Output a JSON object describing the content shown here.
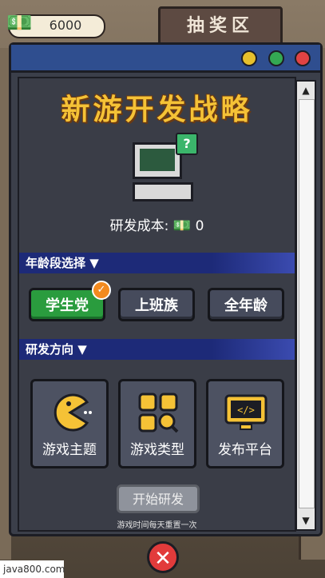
{
  "header": {
    "money": "6000",
    "sign_label": "抽奖区"
  },
  "window": {
    "title": "新游开发战略",
    "cost_label": "研发成本:",
    "cost_value": "0",
    "age_section": {
      "label": "年龄段选择",
      "options": [
        {
          "label": "学生党",
          "selected": true
        },
        {
          "label": "上班族",
          "selected": false
        },
        {
          "label": "全年龄",
          "selected": false
        }
      ]
    },
    "dir_section": {
      "label": "研发方向",
      "cards": [
        {
          "label": "游戏主题",
          "icon": "pacman-icon"
        },
        {
          "label": "游戏类型",
          "icon": "grid-search-icon"
        },
        {
          "label": "发布平台",
          "icon": "code-monitor-icon"
        }
      ]
    },
    "start_button": "开始研发",
    "hint": "游戏时间每天重置一次"
  },
  "watermark": "java800.com",
  "colors": {
    "accent_green": "#2a9c3e",
    "title_yellow": "#f5c236",
    "section_blue": "#1d2a78",
    "close_red": "#e23b3b"
  }
}
